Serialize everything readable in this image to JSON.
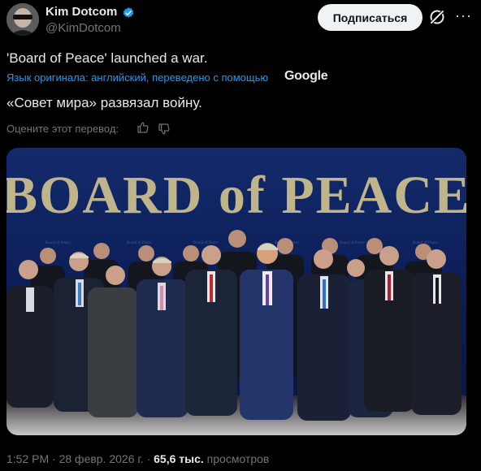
{
  "header": {
    "display_name": "Kim Dotcom",
    "handle": "@KimDotcom",
    "subscribe_label": "Подписаться",
    "more_label": "···"
  },
  "tweet": {
    "original_text": "'Board of Peace' launched a war.",
    "translation_note": "Язык оригинала: английский, переведено с помощью",
    "translation_provider": "Google",
    "translated_text": "«Совет мира» развязал войну.",
    "rate_label": "Оцените этот перевод:"
  },
  "photo": {
    "banner_text": "BOARD of PEACE"
  },
  "footer": {
    "time": "1:52 PM",
    "dot1": " · ",
    "date": "28 февр. 2026 г.",
    "dot2": " · ",
    "views_count": "65,6 тыс.",
    "views_label": " просмотров"
  },
  "colors": {
    "background": "#000000",
    "accent": "#1d9bf0",
    "secondary_text": "#71767b",
    "primary_text": "#e7e9ea"
  },
  "icons": [
    "verified-badge-icon",
    "grok-icon",
    "more-icon",
    "thumb-up-icon",
    "thumb-down-icon"
  ]
}
